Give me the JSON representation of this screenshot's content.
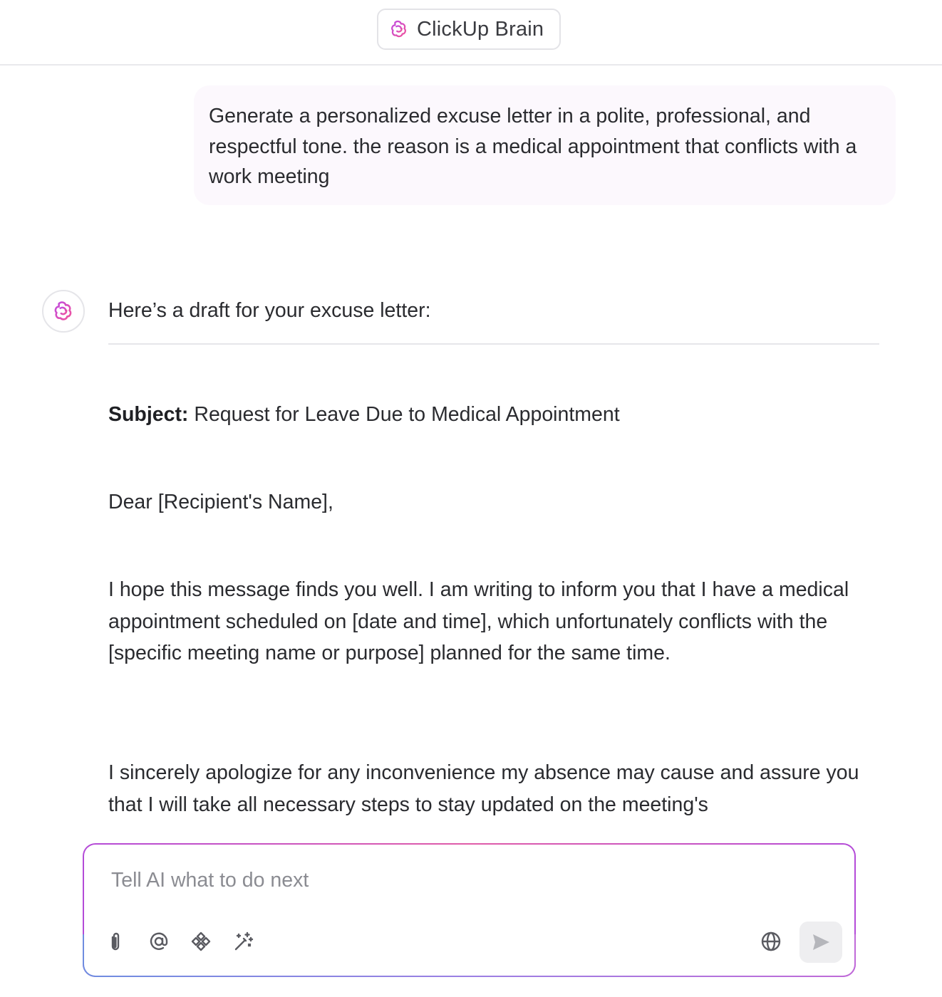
{
  "header": {
    "title": "ClickUp Brain",
    "icon": "brain-icon"
  },
  "conversation": {
    "user_message": "Generate a personalized excuse letter in a polite, professional, and respectful tone. the reason is a medical appointment that conflicts with a work meeting",
    "ai_intro": "Here’s a draft for your excuse letter:",
    "subject_label": "Subject:",
    "subject_text": "Request for Leave Due to Medical Appointment",
    "greeting": "Dear [Recipient's Name],",
    "paragraph_1": "I hope this message finds you well. I am writing to inform you that I have a medical appointment scheduled on [date and time], which unfortunately conflicts with the [specific meeting name or purpose] planned for the same time.",
    "paragraph_2": "I sincerely apologize for any inconvenience my absence may cause and assure you that I will take all necessary steps to stay updated on the meeting's"
  },
  "composer": {
    "placeholder": "Tell AI what to do next",
    "tools": [
      "paperclip-icon",
      "at-mention-icon",
      "integrations-icon",
      "magic-wand-icon"
    ],
    "right_tools": [
      "globe-icon",
      "send-icon"
    ]
  },
  "colors": {
    "brand_pink": "#e04fa8",
    "brand_purple": "#9d4fe0",
    "user_bubble_bg": "#fcf8fd",
    "text": "#2a2b2f"
  }
}
